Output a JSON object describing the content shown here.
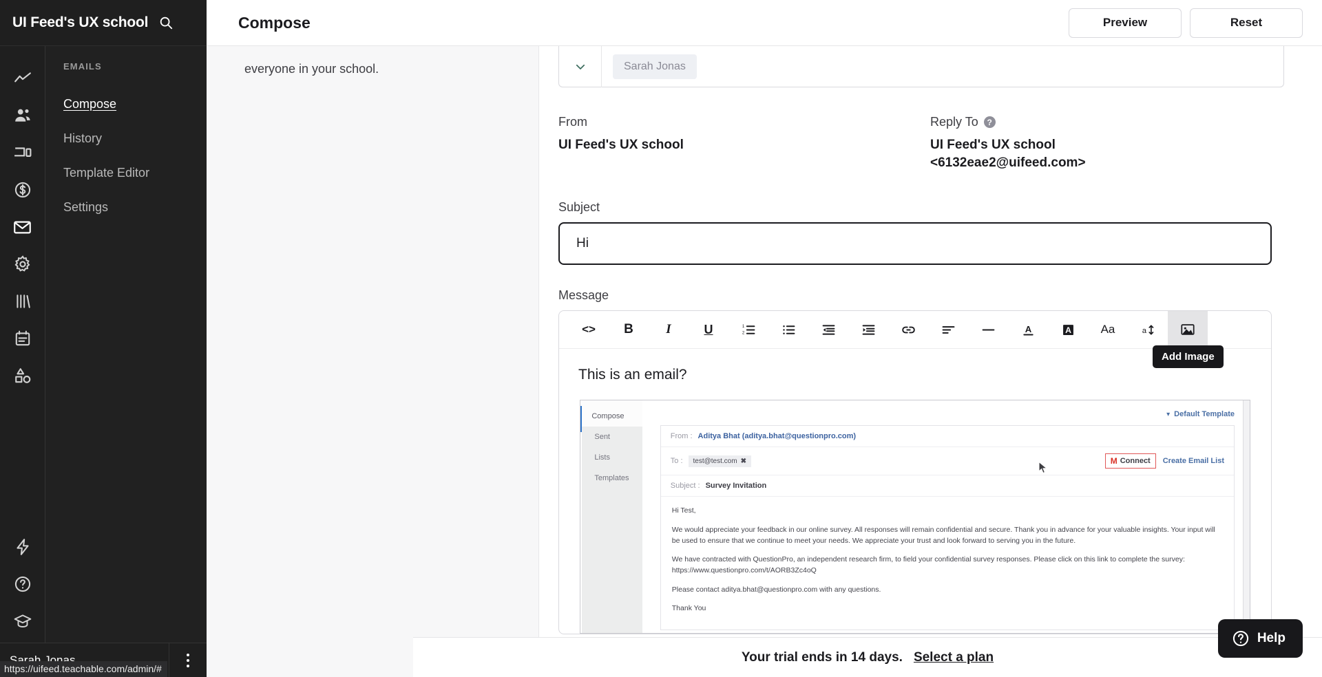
{
  "sidebar": {
    "brand": "UI Feed's UX school",
    "search_icon": "search-icon",
    "rail_icons": [
      {
        "name": "analytics-icon"
      },
      {
        "name": "users-icon"
      },
      {
        "name": "devices-icon"
      },
      {
        "name": "sales-icon"
      },
      {
        "name": "email-icon"
      },
      {
        "name": "settings-gear-icon"
      },
      {
        "name": "library-icon"
      },
      {
        "name": "calendar-icon"
      },
      {
        "name": "shapes-icon"
      },
      {
        "name": "lightning-icon"
      },
      {
        "name": "help-circle-icon"
      },
      {
        "name": "graduation-cap-icon"
      }
    ],
    "section_label": "EMAILS",
    "items": [
      {
        "label": "Compose",
        "active": true
      },
      {
        "label": "History",
        "active": false
      },
      {
        "label": "Template Editor",
        "active": false
      },
      {
        "label": "Settings",
        "active": false
      }
    ],
    "user_name": "Sarah Jonas",
    "status_url": "https://uifeed.teachable.com/admin/#"
  },
  "header": {
    "title": "Compose",
    "preview_label": "Preview",
    "reset_label": "Reset"
  },
  "left_column": {
    "text": "everyone in your school."
  },
  "compose": {
    "recipient_chip": "Sarah Jonas",
    "from_label": "From",
    "from_value": "UI Feed's UX school",
    "reply_to_label": "Reply To",
    "reply_to_name": "UI Feed's UX school",
    "reply_to_email": "<6132eae2@uifeed.com>",
    "subject_label": "Subject",
    "subject_value": "Hi",
    "message_label": "Message",
    "body_text": "This is an email?"
  },
  "toolbar": {
    "tooltip": "Add Image",
    "buttons": [
      {
        "name": "code-view-icon",
        "glyph": "<>"
      },
      {
        "name": "bold-icon",
        "glyph": "B"
      },
      {
        "name": "italic-icon",
        "glyph": "I"
      },
      {
        "name": "underline-icon",
        "glyph": "U"
      },
      {
        "name": "ordered-list-icon",
        "glyph": ""
      },
      {
        "name": "unordered-list-icon",
        "glyph": ""
      },
      {
        "name": "outdent-icon",
        "glyph": ""
      },
      {
        "name": "indent-icon",
        "glyph": ""
      },
      {
        "name": "link-icon",
        "glyph": ""
      },
      {
        "name": "align-left-icon",
        "glyph": ""
      },
      {
        "name": "horizontal-rule-icon",
        "glyph": ""
      },
      {
        "name": "text-color-icon",
        "glyph": "A"
      },
      {
        "name": "highlight-color-icon",
        "glyph": "A"
      },
      {
        "name": "font-family-icon",
        "glyph": "Aa"
      },
      {
        "name": "font-size-icon",
        "glyph": "a"
      },
      {
        "name": "add-image-icon",
        "glyph": ""
      }
    ]
  },
  "embedded_screenshot": {
    "nav": [
      "Compose",
      "Sent",
      "Lists",
      "Templates"
    ],
    "template_label": "Default Template",
    "from_label": "From :",
    "from_value": "Aditya Bhat (aditya.bhat@questionpro.com)",
    "to_label": "To :",
    "to_chip": "test@test.com",
    "connect_label": "Connect",
    "create_list_label": "Create Email List",
    "subject_label": "Subject :",
    "subject_value": "Survey Invitation",
    "body": [
      "Hi Test,",
      "We would appreciate your feedback in our online survey.  All responses will remain confidential and secure. Thank you in advance for your valuable insights. Your input will be used to ensure that we continue to meet your needs. We appreciate your trust and look forward to serving you in the future.",
      "We have contracted with QuestionPro, an independent research firm, to field your confidential survey responses.  Please click on this link to complete the survey: https://www.questionpro.com/t/AORB3Zc4oQ",
      "Please contact aditya.bhat@questionpro.com with any questions.",
      "Thank You"
    ]
  },
  "footer": {
    "trial_text": "Your trial ends in 14 days.",
    "trial_link": "Select a plan",
    "help_label": "Help"
  },
  "colors": {
    "sidebar_bg": "#1f1f1f",
    "accent_dark": "#18181b",
    "link_blue": "#4a6fa5",
    "connect_red": "#e05757"
  }
}
